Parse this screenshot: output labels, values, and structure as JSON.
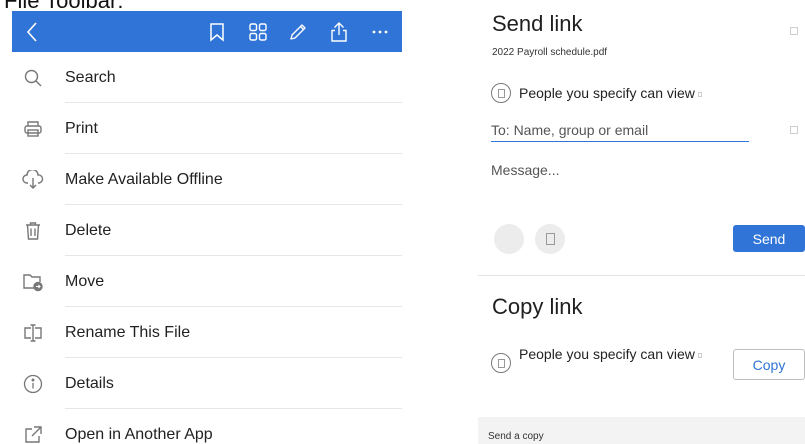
{
  "caption": "File Toolbar:",
  "toolbar": {
    "background": "#2f74d6",
    "icons": [
      "back-icon",
      "bookmark-icon",
      "grid-icon",
      "pencil-icon",
      "share-icon",
      "more-icon"
    ]
  },
  "menu": {
    "items": [
      {
        "label": "Search",
        "icon": "search-icon"
      },
      {
        "label": "Print",
        "icon": "print-icon"
      },
      {
        "label": "Make Available Offline",
        "icon": "cloud-download-icon"
      },
      {
        "label": "Delete",
        "icon": "trash-icon"
      },
      {
        "label": "Move",
        "icon": "move-folder-icon"
      },
      {
        "label": "Rename This File",
        "icon": "rename-icon"
      },
      {
        "label": "Details",
        "icon": "info-icon"
      },
      {
        "label": "Open in Another App",
        "icon": "open-external-icon"
      }
    ]
  },
  "send_link": {
    "title": "Send link",
    "file_name": "2022 Payroll schedule.pdf",
    "permission": "People you specify can view",
    "to_placeholder": "To: Name, group or email",
    "message_placeholder": "Message...",
    "send_label": "Send"
  },
  "copy_link": {
    "title": "Copy link",
    "permission": "People you specify can view",
    "copy_label": "Copy"
  },
  "send_copy": {
    "label": "Send a copy"
  },
  "colors": {
    "accent": "#2f74d6"
  }
}
